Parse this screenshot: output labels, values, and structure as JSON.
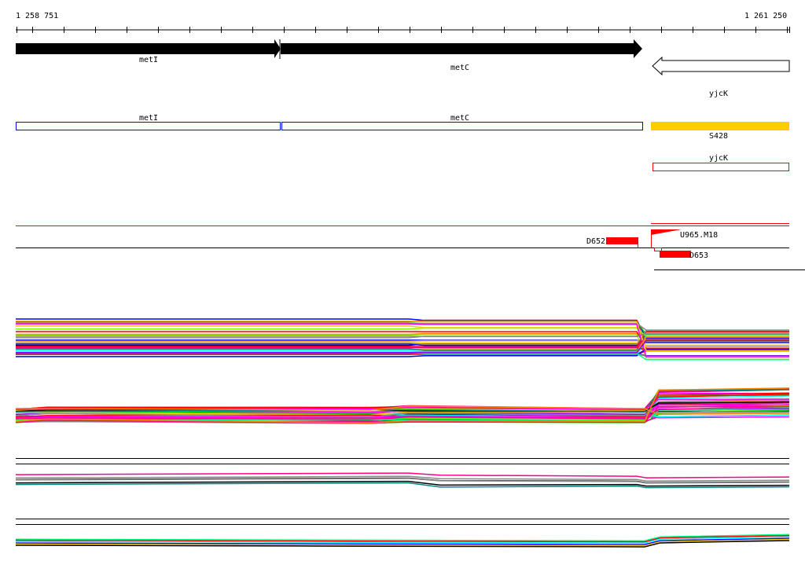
{
  "ruler": {
    "start_label": "1 258 751",
    "end_label": "1 261 250"
  },
  "genes": [
    {
      "name": "metI",
      "strand": "+"
    },
    {
      "name": "metC",
      "strand": "+"
    },
    {
      "name": "yjcK",
      "strand": "-"
    }
  ],
  "annotations": [
    {
      "name": "metI"
    },
    {
      "name": "metC"
    },
    {
      "name": "S428"
    },
    {
      "name": "yjcK"
    }
  ],
  "features": [
    {
      "name": "D652"
    },
    {
      "name": "U965.M18"
    },
    {
      "name": "D653"
    }
  ],
  "colors": {
    "gene_fill": "#000000",
    "annotation_outline": "#0000ff",
    "s428_fill": "#ffcc00",
    "feature_red": "#ff0000"
  },
  "palette": [
    "#ff00ff",
    "#00cc00",
    "#0000ff",
    "#ff0000",
    "#00ffff",
    "#ff8800",
    "#000000",
    "#88ff00",
    "#8800ff",
    "#ffcc00",
    "#ff0088",
    "#008888",
    "#888888",
    "#00ff88"
  ]
}
